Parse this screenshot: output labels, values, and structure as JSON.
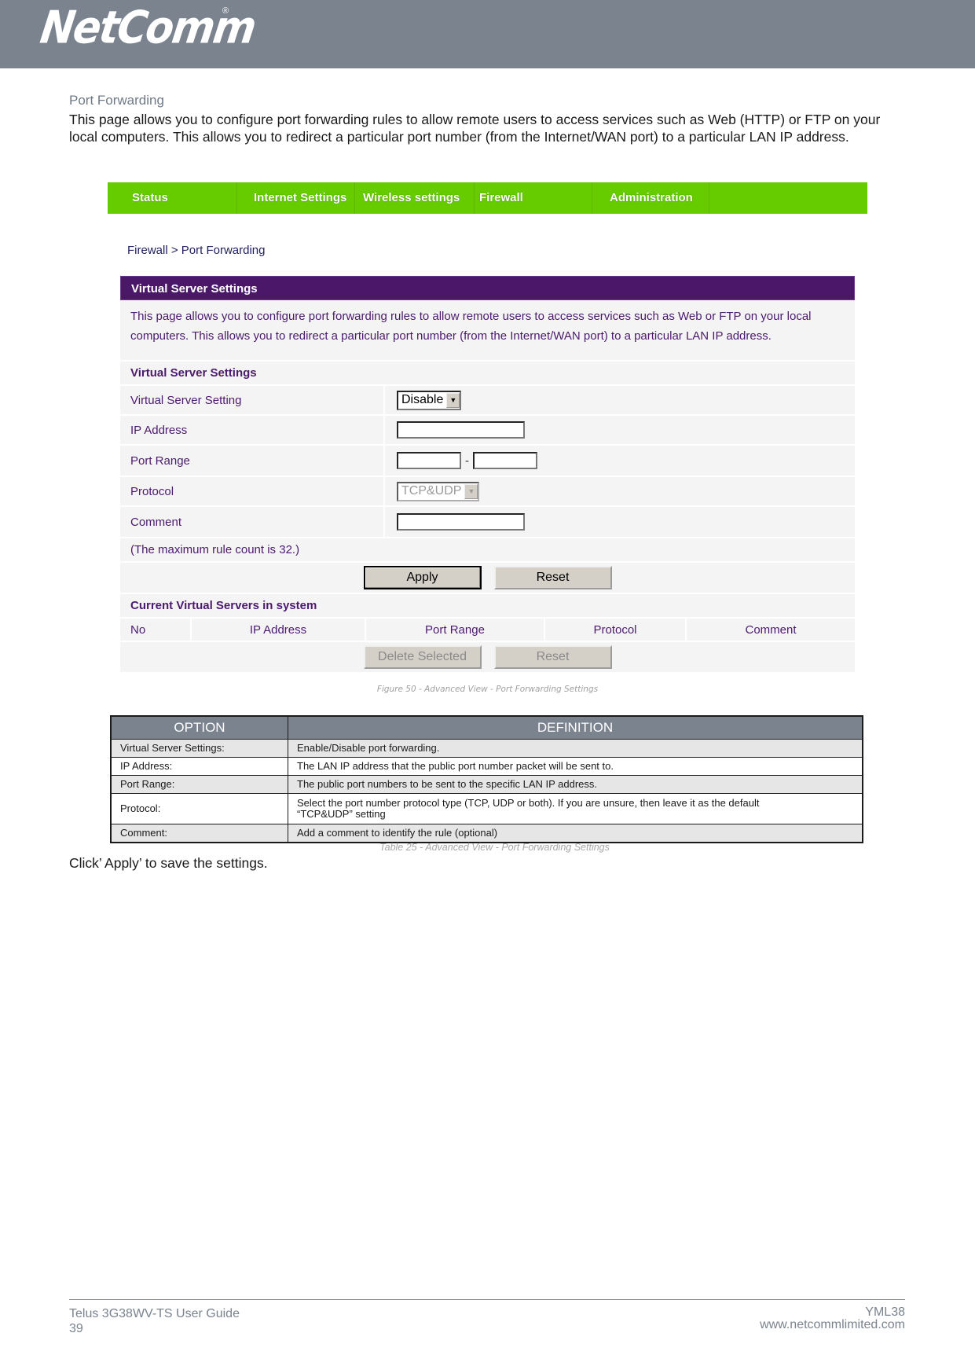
{
  "header": {
    "logo_text": "NetComm",
    "registered_mark": "®",
    "brand_color": "#7a838e"
  },
  "section": {
    "title": "Port Forwarding",
    "intro": "This page allows you to configure port forwarding rules to allow remote users to access services such as Web (HTTP) or FTP on your local computers. This allows you to redirect a particular port number (from the Internet/WAN port) to a particular LAN IP address."
  },
  "router_ui": {
    "nav": {
      "accent": "#66cc00",
      "items": [
        {
          "label": "Status"
        },
        {
          "label": "Internet Settings"
        },
        {
          "label": "Wireless settings"
        },
        {
          "label": "Firewall"
        },
        {
          "label": "Administration"
        },
        {
          "label": ""
        }
      ]
    },
    "breadcrumb": "Firewall > Port Forwarding",
    "panel_title": "Virtual Server Settings",
    "panel_color": "#4b1869",
    "description": "This page allows you to configure port forwarding rules to allow remote users to access services such as Web or FTP on your local computers. This allows you to redirect a particular port number (from the Internet/WAN port) to a particular LAN IP address.",
    "settings_heading": "Virtual Server Settings",
    "fields": {
      "virtual_server_setting": {
        "label": "Virtual Server Setting",
        "value": "Disable"
      },
      "ip_address": {
        "label": "IP Address",
        "value": ""
      },
      "port_range": {
        "label": "Port Range",
        "from": "",
        "to": "",
        "separator": "-"
      },
      "protocol": {
        "label": "Protocol",
        "value": "TCP&UDP"
      },
      "comment": {
        "label": "Comment",
        "value": ""
      }
    },
    "rule_count_note": "(The maximum rule count is 32.)",
    "apply_label": "Apply",
    "reset_label": "Reset",
    "current_heading": "Current Virtual Servers in system",
    "table_columns": [
      "No",
      "IP Address",
      "Port Range",
      "Protocol",
      "Comment"
    ],
    "delete_selected_label": "Delete Selected",
    "reset2_label": "Reset"
  },
  "figure_caption": "Figure 50 - Advanced View - Port Forwarding Settings",
  "definition_table": {
    "headers": [
      "OPTION",
      "DEFINITION"
    ],
    "rows": [
      {
        "option": "Virtual Server Settings:",
        "definition": "Enable/Disable port forwarding."
      },
      {
        "option": "IP Address:",
        "definition": "The LAN IP address that the public port number packet will be sent to."
      },
      {
        "option": "Port Range:",
        "definition": "The public port numbers to be sent to the specific LAN IP address."
      },
      {
        "option": "Protocol:",
        "definition": "Select the port number protocol type (TCP, UDP or both). If you are unsure, then leave it as the default “TCP&UDP” setting"
      },
      {
        "option": "Comment:",
        "definition": "Add a comment to identify the rule (optional)"
      }
    ]
  },
  "table_caption": "Table 25 - Advanced View - Port Forwarding Settings",
  "click_note": "Click’ Apply’ to save the settings.",
  "footer": {
    "guide_title": "Telus 3G38WV-TS User Guide",
    "page_number": "39",
    "model": "YML38",
    "website": "www.netcommlimited.com"
  }
}
